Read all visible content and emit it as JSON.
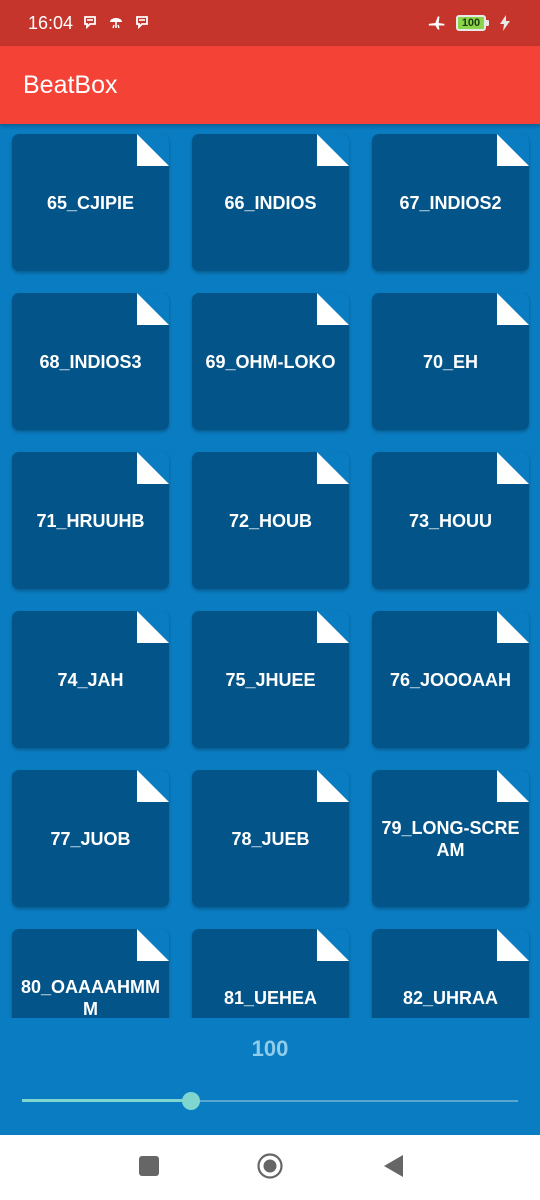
{
  "status_bar": {
    "time": "16:04",
    "battery": "100"
  },
  "app_bar": {
    "title": "BeatBox"
  },
  "sounds": [
    "65_CJIPIE",
    "66_INDIOS",
    "67_INDIOS2",
    "68_INDIOS3",
    "69_OHM-LOKO",
    "70_EH",
    "71_HRUUHB",
    "72_HOUB",
    "73_HOUU",
    "74_JAH",
    "75_JHUEE",
    "76_JOOOAAH",
    "77_JUOB",
    "78_JUEB",
    "79_LONG-SCREAM",
    "80_OAAAAHMMM",
    "81_UEHEA",
    "82_UHRAA"
  ],
  "playback": {
    "speed_label": "100",
    "slider_fraction": 0.34
  },
  "colors": {
    "status_bar": "#c5352c",
    "app_bar": "#f44336",
    "background": "#0a7cc1",
    "tile": "#035589",
    "slider_accent": "#7fd6cf",
    "speed_text": "#8fcdea"
  },
  "icons": {
    "status": [
      "messaging-icon",
      "weather-icon",
      "messaging-icon"
    ],
    "airplane": "airplane-icon",
    "charging": "charging-icon",
    "nav": [
      "recents-icon",
      "home-icon",
      "back-icon"
    ]
  }
}
